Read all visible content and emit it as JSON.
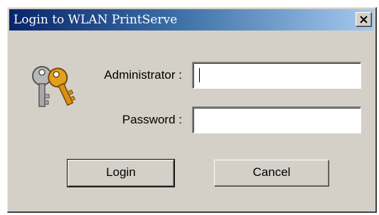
{
  "window": {
    "title": "Login to WLAN PrintServe"
  },
  "form": {
    "administrator_label": "Administrator :",
    "administrator_value": "",
    "password_label": "Password :",
    "password_value": ""
  },
  "buttons": {
    "login_label": "Login",
    "cancel_label": "Cancel"
  },
  "icons": {
    "title_close": "close-icon",
    "dialog": "keys-icon"
  },
  "colors": {
    "titlebar_start": "#0a246a",
    "titlebar_end": "#a6caf0",
    "dialog_face": "#d4d0c8"
  }
}
